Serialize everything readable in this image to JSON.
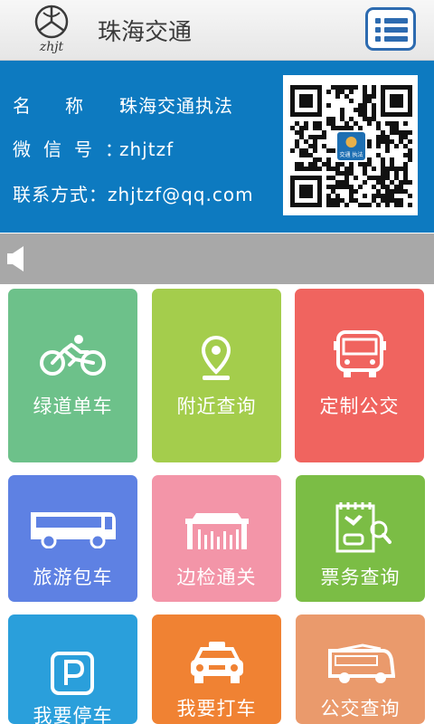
{
  "header": {
    "title": "珠海交通",
    "logo_text": "zhjt"
  },
  "info": {
    "name_label": "名称：",
    "name_value": "珠海交通执法",
    "wechat_label": "微信号：",
    "wechat_value": "zhjtzf",
    "contact_label": "联系方式：",
    "contact_value": "zhjtzf@qq.com",
    "qr_center_text": "交通 执法"
  },
  "tiles": [
    {
      "label": "绿道单车",
      "icon": "bicycle-icon",
      "color": "#6dc18a"
    },
    {
      "label": "附近查询",
      "icon": "location-pin-icon",
      "color": "#a4cd4c"
    },
    {
      "label": "定制公交",
      "icon": "bus-front-icon",
      "color": "#f0645f"
    },
    {
      "label": "旅游包车",
      "icon": "coach-bus-icon",
      "color": "#5e81e3"
    },
    {
      "label": "边检通关",
      "icon": "border-gate-icon",
      "color": "#f395a8"
    },
    {
      "label": "票务查询",
      "icon": "ticket-search-icon",
      "color": "#7bbd45"
    },
    {
      "label": "我要停车",
      "icon": "parking-icon",
      "color": "#2a9fdb"
    },
    {
      "label": "我要打车",
      "icon": "taxi-icon",
      "color": "#f08233"
    },
    {
      "label": "公交查询",
      "icon": "bus-side-icon",
      "color": "#ea9a6c"
    }
  ]
}
